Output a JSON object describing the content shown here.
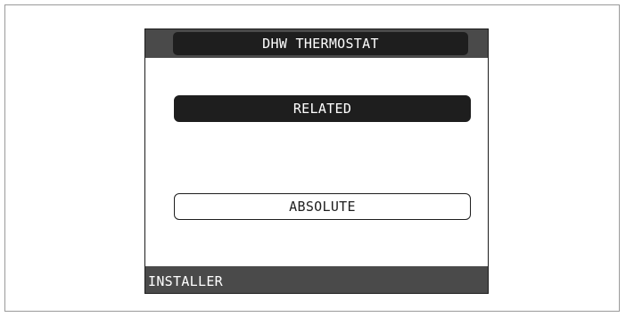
{
  "screen": {
    "title": "DHW THERMOSTAT",
    "options": [
      {
        "label": "RELATED",
        "selected": true
      },
      {
        "label": "ABSOLUTE",
        "selected": false
      }
    ],
    "footer": "INSTALLER"
  },
  "colors": {
    "bar_gray": "#4a4a4a",
    "dark": "#1e1e1e",
    "light": "#ffffff"
  }
}
